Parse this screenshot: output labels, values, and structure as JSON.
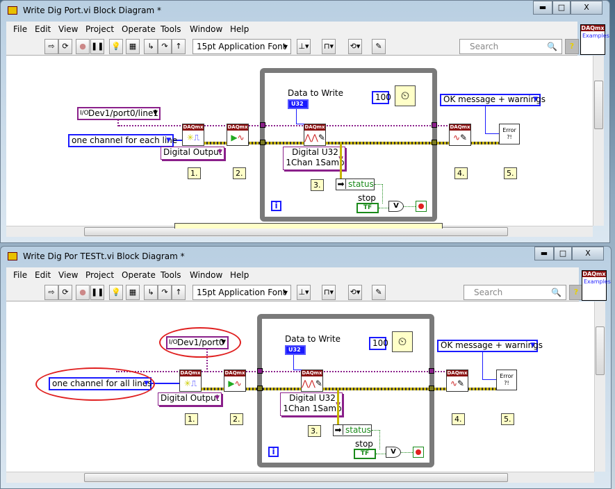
{
  "windows": [
    {
      "title": "Write Dig Port.vi Block Diagram *",
      "menus": [
        "File",
        "Edit",
        "View",
        "Project",
        "Operate",
        "Tools",
        "Window",
        "Help"
      ],
      "font_select": "15pt Application Font",
      "search_placeholder": "Search",
      "daqmx_examples": {
        "logo": "DAQmx",
        "text": "Examples"
      },
      "diagram": {
        "channel_constant": "Dev1/port0/line1",
        "line_grouping": "one channel for each line",
        "channel_type": "Digital Output",
        "data_to_write_label": "Data to Write",
        "data_type": "U32",
        "write_mode_line1": "Digital U32",
        "write_mode_line2": "1Chan 1Samp",
        "wait_ms": "100",
        "error_handler": "OK message + warnings",
        "status": "status",
        "stop_label": "stop",
        "stop_bool": "TF",
        "or_gate": "V",
        "iteration": "i",
        "step_labels": [
          "1.",
          "2.",
          "3.",
          "4.",
          "5."
        ],
        "vi_header": "DAQmx",
        "error_vi": "Error ?!"
      }
    },
    {
      "title": "Write Dig Por TESTt.vi Block Diagram *",
      "menus": [
        "File",
        "Edit",
        "View",
        "Project",
        "Operate",
        "Tools",
        "Window",
        "Help"
      ],
      "font_select": "15pt Application Font",
      "search_placeholder": "Search",
      "daqmx_examples": {
        "logo": "DAQmx",
        "text": "Examples"
      },
      "diagram": {
        "channel_constant": "Dev1/port0",
        "line_grouping": "one channel for all lines",
        "channel_type": "Digital Output",
        "data_to_write_label": "Data to Write",
        "data_type": "U32",
        "write_mode_line1": "Digital U32",
        "write_mode_line2": "1Chan 1Samp",
        "wait_ms": "100",
        "error_handler": "OK message + warnings",
        "status": "status",
        "stop_label": "stop",
        "stop_bool": "TF",
        "or_gate": "V",
        "iteration": "i",
        "step_labels": [
          "1.",
          "2.",
          "3.",
          "4.",
          "5."
        ],
        "vi_header": "DAQmx",
        "error_vi": "Error ?!"
      }
    }
  ],
  "colors": {
    "wire_task": "#8a1f8a",
    "wire_error": "#c8b400",
    "annotation": "#e02020",
    "vi_header": "#8b1010"
  }
}
